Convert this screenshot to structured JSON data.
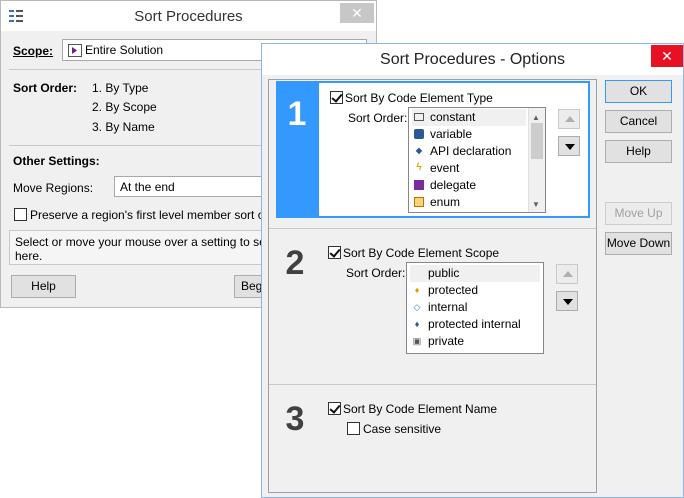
{
  "back_window": {
    "title": "Sort Procedures",
    "scope_label": "Scope:",
    "scope_value": "Entire Solution",
    "sort_order_label": "Sort Order:",
    "sort_order_items": [
      "1. By Type",
      "2. By Scope",
      "3. By Name"
    ],
    "other_settings_label": "Other Settings:",
    "move_regions_label": "Move Regions:",
    "move_regions_value": "At the end",
    "preserve_label": "Preserve a region's first level member sort order",
    "hint_line1": "Select or move your mouse over a setting to see a d",
    "hint_line2": "here.",
    "help_button": "Help",
    "begin_button": "Begi"
  },
  "options_window": {
    "title": "Sort Procedures - Options",
    "ok_button": "OK",
    "cancel_button": "Cancel",
    "help_button": "Help",
    "move_up_button": "Move Up",
    "move_down_button": "Move Down",
    "sort_order_label": "Sort Order:",
    "sections": [
      {
        "number": "1",
        "checkbox_label": "Sort By Code Element Type",
        "items": [
          "constant",
          "variable",
          "API declaration",
          "event",
          "delegate",
          "enum"
        ]
      },
      {
        "number": "2",
        "checkbox_label": "Sort By Code Element Scope",
        "items": [
          "public",
          "protected",
          "internal",
          "protected internal",
          "private"
        ]
      },
      {
        "number": "3",
        "checkbox_label": "Sort By Code Element Name",
        "case_label": "Case sensitive"
      }
    ]
  },
  "colors": {
    "accent": "#3399ff",
    "close_red": "#e81123"
  }
}
